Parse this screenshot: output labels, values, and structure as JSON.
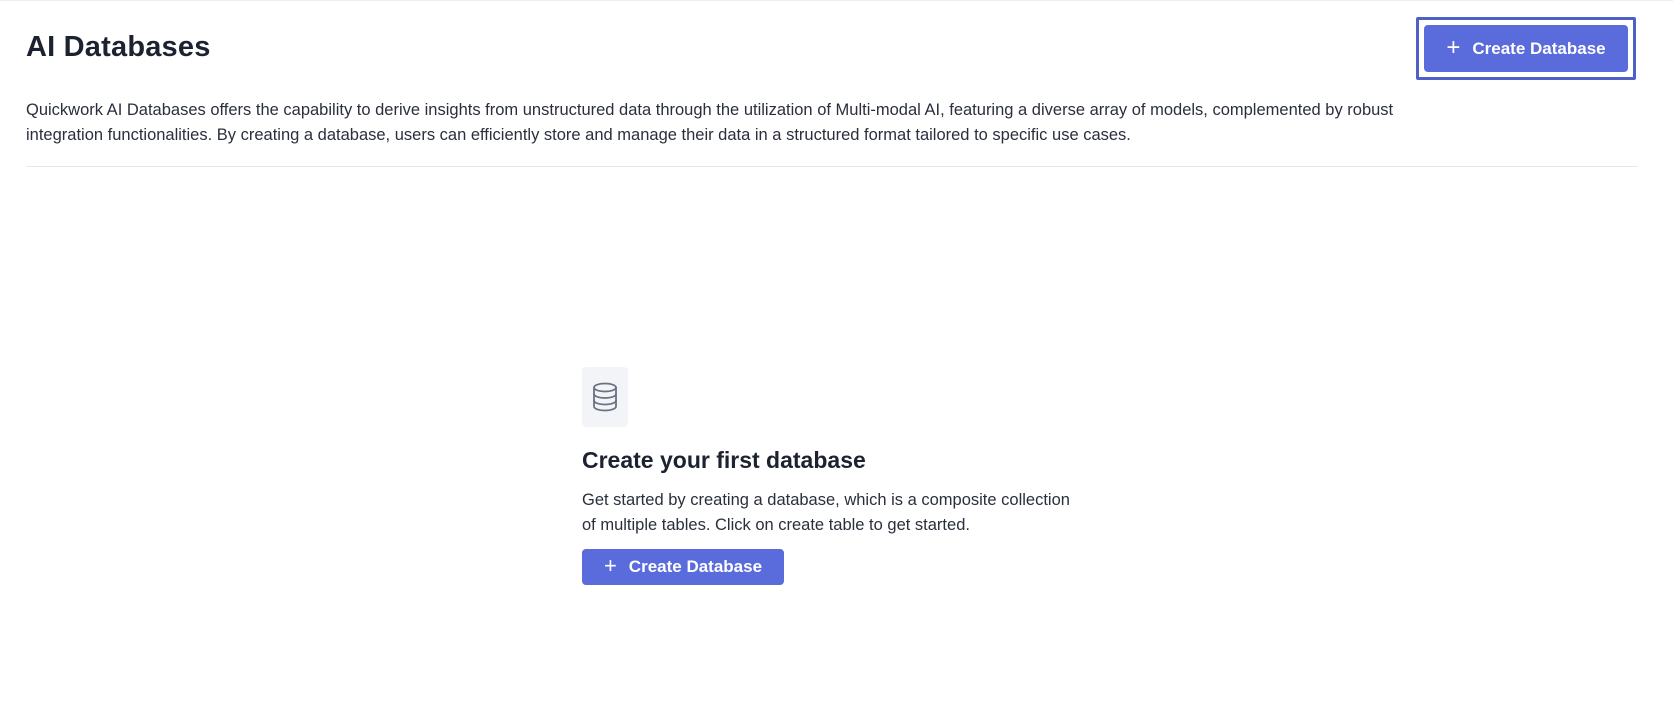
{
  "header": {
    "title": "AI Databases",
    "create_button_label": "Create Database",
    "create_button_icon": "+"
  },
  "description": "Quickwork AI Databases offers the capability to derive insights from unstructured data through the utilization of Multi-modal AI, featuring a diverse array of models, complemented by robust integration functionalities. By creating a database, users can efficiently store and manage their data in a structured format tailored to specific use cases.",
  "empty_state": {
    "icon": "database-icon",
    "title": "Create your first database",
    "text": "Get started by creating a database, which is a composite collection of multiple tables. Click on create table to get started.",
    "button_label": "Create Database",
    "button_icon": "+"
  },
  "colors": {
    "primary": "#5a6bdb",
    "focus_outline": "#4e60c8",
    "title_text": "#1d2230",
    "icon_bg": "#f2f4f8"
  }
}
